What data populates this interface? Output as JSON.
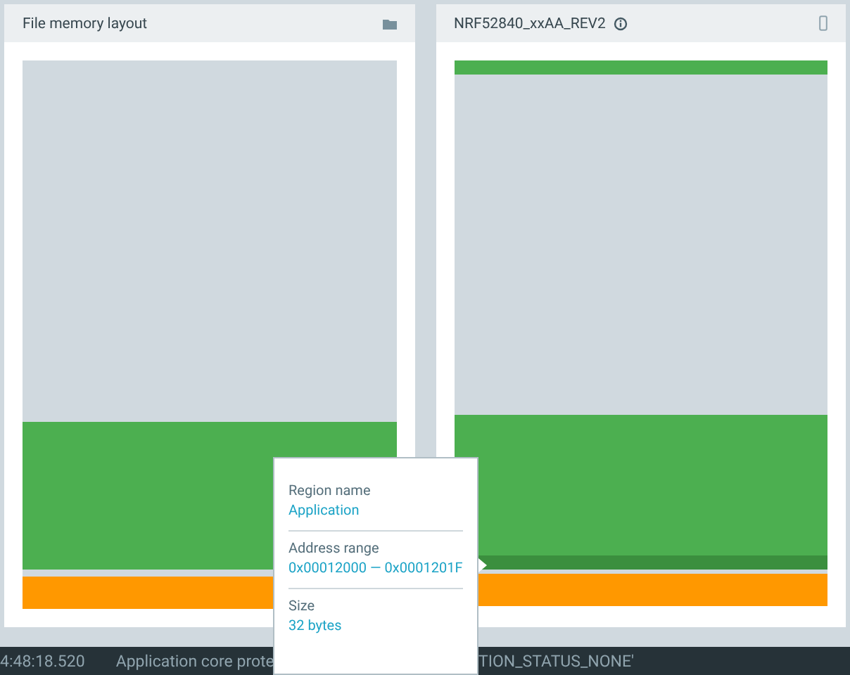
{
  "panels": [
    {
      "title": "File memory layout",
      "segments": [
        {
          "color": "#d0d9df"
        },
        {
          "color": "#4caf50"
        },
        {
          "color": "#d0d9df"
        },
        {
          "color": "#ff9800"
        }
      ]
    },
    {
      "title": "NRF52840_xxAA_REV2",
      "segments": [
        {
          "color": "#4caf50"
        },
        {
          "color": "#d0d9df"
        },
        {
          "color": "#4caf50"
        },
        {
          "color": "#3b8f3e"
        },
        {
          "color": "#d0d9df"
        },
        {
          "color": "#ff9800"
        }
      ]
    }
  ],
  "tooltip": {
    "fields": [
      {
        "label": "Region name",
        "value": "Application"
      },
      {
        "label": "Address range",
        "value": "0x00012000 — 0x0001201F"
      },
      {
        "label": "Size",
        "value": "32 bytes"
      }
    ]
  },
  "log": {
    "time": "4:48:18.520",
    "message_start": "Application core prote",
    "message_end": "TION_STATUS_NONE'"
  }
}
